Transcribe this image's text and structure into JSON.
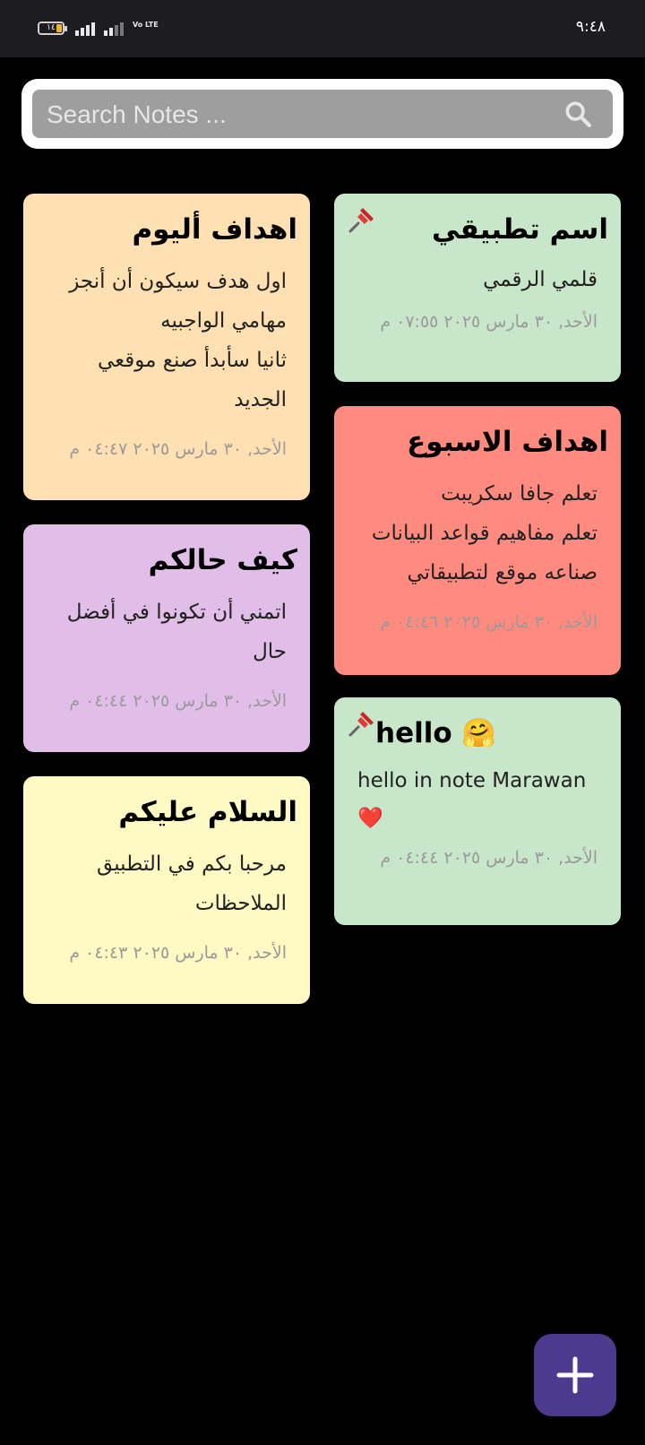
{
  "status_bar": {
    "battery_level": "١٤",
    "network_label": "Vo LTE",
    "clock": "٩:٤٨"
  },
  "search": {
    "placeholder": "Search Notes ..."
  },
  "notes": [
    {
      "title": "اسم تطبيقي",
      "body": "قلمي الرقمي",
      "date": "الأحد, ٣٠ مارس ٢٠٢٥ ٠٧:٥٥ م",
      "color": "#c8e6c9",
      "pinned": true
    },
    {
      "title": "اهداف الاسبوع",
      "body_lines": [
        "تعلم جافا سكريبت",
        "تعلم مفاهيم قواعد البيانات",
        "صناعه موقع لتطبيقاتي"
      ],
      "date": "الأحد, ٣٠ مارس ٢٠٢٥ ٠٤:٤٦ م",
      "color": "#ff8a80",
      "pinned": false
    },
    {
      "title": "hello 🤗",
      "body": "hello in note Marawan",
      "emoji": "❤️",
      "date": "الأحد, ٣٠ مارس ٢٠٢٥ ٠٤:٤٤ م",
      "color": "#c8e6c9",
      "pinned": true
    },
    {
      "title": "اهداف أليوم",
      "body_lines": [
        "اول هدف سيكون أن أنجز",
        "مهامي الواجبيه",
        "ثانيا سأبدأ صنع موقعي",
        "الجديد"
      ],
      "date": "الأحد, ٣٠ مارس ٢٠٢٥ ٠٤:٤٧ م",
      "color": "#ffe0b2",
      "pinned": false
    },
    {
      "title": "كيف حالكم",
      "body_lines": [
        "اتمني أن تكونوا في أفضل",
        "حال"
      ],
      "date": "الأحد, ٣٠ مارس ٢٠٢٥ ٠٤:٤٤ م",
      "color": "#e1bee7",
      "pinned": false
    },
    {
      "title": "السلام عليكم",
      "body_lines": [
        "مرحبا بكم في التطبيق",
        "الملاحظات"
      ],
      "date": "الأحد, ٣٠ مارس ٢٠٢٥ ٠٤:٤٣ م",
      "color": "#fff9c4",
      "pinned": false
    }
  ],
  "icons": {
    "search": "search-icon",
    "pin": "pin-icon",
    "add": "plus-icon"
  },
  "colors": {
    "background": "#000000",
    "status_bar": "#1c1c21",
    "fab": "#4c3a8f"
  }
}
